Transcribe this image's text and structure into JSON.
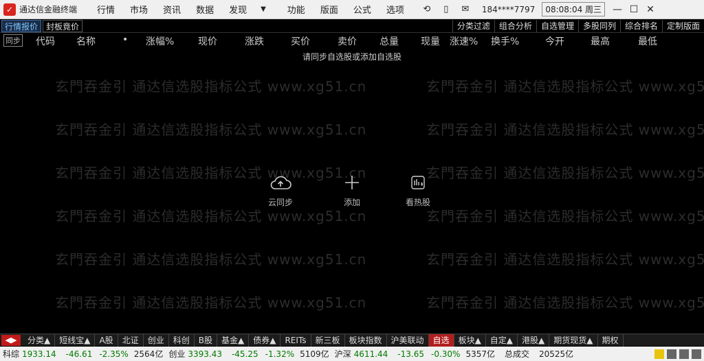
{
  "titlebar": {
    "app_name": "通达信金融终端",
    "menu": [
      "行情",
      "市场",
      "资讯",
      "数据",
      "发现"
    ],
    "menu2": [
      "功能",
      "版面",
      "公式",
      "选项"
    ],
    "user": "184****7797",
    "clock": "08:08:04 周三",
    "win_buttons": [
      "—",
      "☐",
      "✕"
    ]
  },
  "toolbar2": {
    "left_tabs": [
      "行情报价",
      "封板竟价"
    ],
    "right_tabs": [
      "分类过滤",
      "组合分析",
      "自选管理",
      "多股同列",
      "综合排名",
      "定制版面"
    ]
  },
  "table": {
    "sync": "同步",
    "columns": [
      "代码",
      "名称",
      "•",
      "涨幅%",
      "现价",
      "涨跌",
      "买价",
      "卖价",
      "总量",
      "现量",
      "涨速%",
      "换手%",
      "今开",
      "最高",
      "最低"
    ],
    "hint": "请同步自选股或添加自选股"
  },
  "watermark": "玄門吞金引 通达信选股指标公式 www.xg51.cn",
  "actions": [
    {
      "label": "云同步",
      "icon": "cloud-upload-icon"
    },
    {
      "label": "添加",
      "icon": "plus-icon"
    },
    {
      "label": "看热股",
      "icon": "hot-stock-icon"
    }
  ],
  "bottom_tabs": [
    "分类▲",
    "短线宝▲",
    "A股",
    "北证",
    "创业",
    "科创",
    "B股",
    "基金▲",
    "债券▲",
    "REITs",
    "新三板",
    "板块指数",
    "沪美联动",
    "自选",
    "板块▲",
    "自定▲",
    "港股▲",
    "期货现货▲",
    "期权"
  ],
  "bottom_active": "自选",
  "status": {
    "items": [
      {
        "label": "科综",
        "value": "1933.14",
        "change": "-46.61",
        "pct": "-2.35%",
        "amount": "2564亿"
      },
      {
        "label": "创业",
        "value": "3393.43",
        "change": "-45.25",
        "pct": "-1.32%",
        "amount": "5109亿"
      },
      {
        "label": "沪深",
        "value": "4611.44",
        "change": "-13.65",
        "pct": "-0.30%",
        "amount": "5357亿"
      }
    ],
    "total_label": "总成交",
    "total_value": "20525亿"
  }
}
